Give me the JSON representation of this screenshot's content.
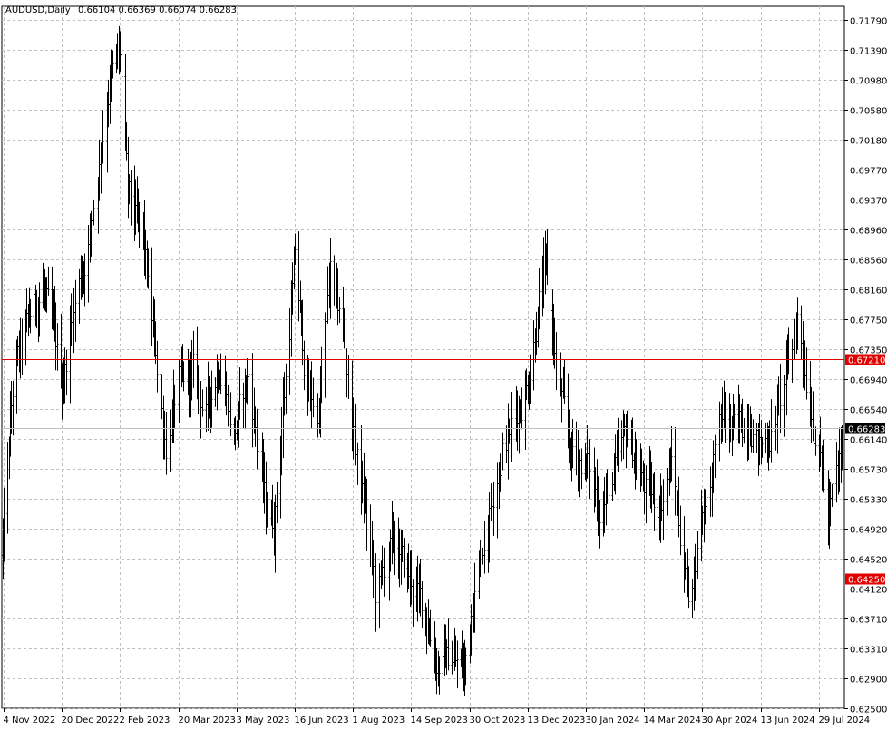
{
  "header": {
    "symbol": "AUDUSD,Daily",
    "ohlc": "0.66104 0.66369 0.66074 0.66283"
  },
  "colors": {
    "background": "#ffffff",
    "bars": "#000000",
    "grid": "#c0c0c0",
    "level_line": "#e00000",
    "current_badge": "#000000"
  },
  "chart_data": {
    "type": "bar",
    "style": "ohlc",
    "grid": true,
    "ylim": [
      0.625,
      0.72
    ],
    "ytick_labels": [
      "0.71790",
      "0.71390",
      "0.70980",
      "0.70580",
      "0.70180",
      "0.69770",
      "0.69370",
      "0.68960",
      "0.68560",
      "0.68160",
      "0.67750",
      "0.67350",
      "0.66940",
      "0.66540",
      "0.66140",
      "0.65730",
      "0.65330",
      "0.64920",
      "0.64520",
      "0.64120",
      "0.63710",
      "0.63310",
      "0.62900",
      "0.62500"
    ],
    "xtick_labels": [
      "4 Nov 2022",
      "20 Dec 2022",
      "2 Feb 2023",
      "20 Mar 2023",
      "3 May 2023",
      "16 Jun 2023",
      "1 Aug 2023",
      "14 Sep 2023",
      "30 Oct 2023",
      "13 Dec 2023",
      "30 Jan 2024",
      "14 Mar 2024",
      "30 Apr 2024",
      "13 Jun 2024",
      "29 Jul 2024"
    ],
    "levels": [
      {
        "label": "0.67210",
        "value": 0.6721
      },
      {
        "label": "0.64250",
        "value": 0.6425
      }
    ],
    "current_price": {
      "label": "0.66283",
      "value": 0.66283
    },
    "anchors": [
      {
        "date": "2022-11-01",
        "price": 0.64
      },
      {
        "date": "2022-11-04",
        "price": 0.65
      },
      {
        "date": "2022-11-12",
        "price": 0.67
      },
      {
        "date": "2022-11-25",
        "price": 0.678
      },
      {
        "date": "2022-12-05",
        "price": 0.682
      },
      {
        "date": "2022-12-12",
        "price": 0.676
      },
      {
        "date": "2022-12-20",
        "price": 0.669
      },
      {
        "date": "2022-12-30",
        "price": 0.68
      },
      {
        "date": "2023-01-10",
        "price": 0.689
      },
      {
        "date": "2023-01-25",
        "price": 0.71
      },
      {
        "date": "2023-02-02",
        "price": 0.713
      },
      {
        "date": "2023-02-08",
        "price": 0.694
      },
      {
        "date": "2023-02-20",
        "price": 0.688
      },
      {
        "date": "2023-03-01",
        "price": 0.674
      },
      {
        "date": "2023-03-10",
        "price": 0.661
      },
      {
        "date": "2023-03-20",
        "price": 0.668
      },
      {
        "date": "2023-03-31",
        "price": 0.67
      },
      {
        "date": "2023-04-10",
        "price": 0.665
      },
      {
        "date": "2023-04-20",
        "price": 0.672
      },
      {
        "date": "2023-05-01",
        "price": 0.662
      },
      {
        "date": "2023-05-12",
        "price": 0.67
      },
      {
        "date": "2023-05-25",
        "price": 0.652
      },
      {
        "date": "2023-05-31",
        "price": 0.65
      },
      {
        "date": "2023-06-10",
        "price": 0.672
      },
      {
        "date": "2023-06-16",
        "price": 0.686
      },
      {
        "date": "2023-06-25",
        "price": 0.668
      },
      {
        "date": "2023-07-05",
        "price": 0.665
      },
      {
        "date": "2023-07-14",
        "price": 0.684
      },
      {
        "date": "2023-07-25",
        "price": 0.675
      },
      {
        "date": "2023-08-01",
        "price": 0.662
      },
      {
        "date": "2023-08-10",
        "price": 0.652
      },
      {
        "date": "2023-08-18",
        "price": 0.64
      },
      {
        "date": "2023-08-31",
        "price": 0.647
      },
      {
        "date": "2023-09-14",
        "price": 0.642
      },
      {
        "date": "2023-09-25",
        "price": 0.638
      },
      {
        "date": "2023-10-05",
        "price": 0.631
      },
      {
        "date": "2023-10-15",
        "price": 0.632
      },
      {
        "date": "2023-10-26",
        "price": 0.63
      },
      {
        "date": "2023-11-01",
        "price": 0.64
      },
      {
        "date": "2023-11-10",
        "price": 0.648
      },
      {
        "date": "2023-11-20",
        "price": 0.658
      },
      {
        "date": "2023-12-01",
        "price": 0.663
      },
      {
        "date": "2023-12-13",
        "price": 0.669
      },
      {
        "date": "2023-12-22",
        "price": 0.68
      },
      {
        "date": "2023-12-28",
        "price": 0.684
      },
      {
        "date": "2024-01-05",
        "price": 0.672
      },
      {
        "date": "2024-01-16",
        "price": 0.66
      },
      {
        "date": "2024-01-30",
        "price": 0.658
      },
      {
        "date": "2024-02-10",
        "price": 0.652
      },
      {
        "date": "2024-02-20",
        "price": 0.656
      },
      {
        "date": "2024-03-01",
        "price": 0.662
      },
      {
        "date": "2024-03-08",
        "price": 0.658
      },
      {
        "date": "2024-03-14",
        "price": 0.655
      },
      {
        "date": "2024-03-25",
        "price": 0.652
      },
      {
        "date": "2024-04-05",
        "price": 0.658
      },
      {
        "date": "2024-04-19",
        "price": 0.64
      },
      {
        "date": "2024-04-30",
        "price": 0.652
      },
      {
        "date": "2024-05-15",
        "price": 0.664
      },
      {
        "date": "2024-05-25",
        "price": 0.662
      },
      {
        "date": "2024-06-05",
        "price": 0.665
      },
      {
        "date": "2024-06-13",
        "price": 0.66
      },
      {
        "date": "2024-06-25",
        "price": 0.664
      },
      {
        "date": "2024-07-01",
        "price": 0.668
      },
      {
        "date": "2024-07-08",
        "price": 0.673
      },
      {
        "date": "2024-07-12",
        "price": 0.678
      },
      {
        "date": "2024-07-19",
        "price": 0.67
      },
      {
        "date": "2024-07-29",
        "price": 0.66
      },
      {
        "date": "2024-08-05",
        "price": 0.65
      },
      {
        "date": "2024-08-12",
        "price": 0.656
      },
      {
        "date": "2024-08-19",
        "price": 0.662
      }
    ]
  }
}
